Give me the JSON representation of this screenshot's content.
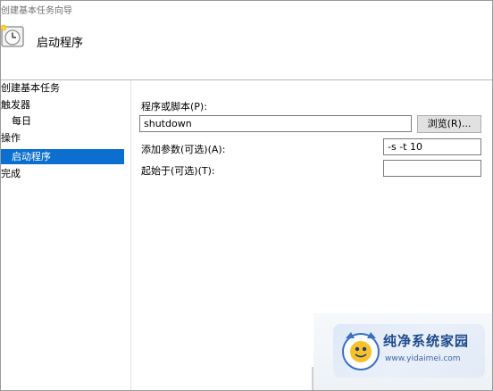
{
  "window": {
    "title": "创建基本任务向导"
  },
  "header": {
    "title": "启动程序",
    "icon": "scheduled-task-clock-icon"
  },
  "sidebar": {
    "items": [
      {
        "label": "创建基本任务",
        "indent": false,
        "active": false
      },
      {
        "label": "触发器",
        "indent": false,
        "active": false
      },
      {
        "label": "每日",
        "indent": true,
        "active": false
      },
      {
        "label": "操作",
        "indent": false,
        "active": false
      },
      {
        "label": "启动程序",
        "indent": true,
        "active": true
      },
      {
        "label": "完成",
        "indent": false,
        "active": false
      }
    ]
  },
  "form": {
    "program_label": "程序或脚本(P):",
    "program_value": "shutdown",
    "browse_label": "浏览(R)...",
    "args_label": "添加参数(可选)(A):",
    "args_value": "-s -t 10",
    "start_in_label": "起始于(可选)(T):",
    "start_in_value": ""
  },
  "watermark": {
    "text": "纯净系统家园",
    "url": "www.yidaimei.com"
  },
  "colors": {
    "accent": "#0a6fcf",
    "border": "#7a7a7a",
    "button_face": "#e1e1e1"
  }
}
